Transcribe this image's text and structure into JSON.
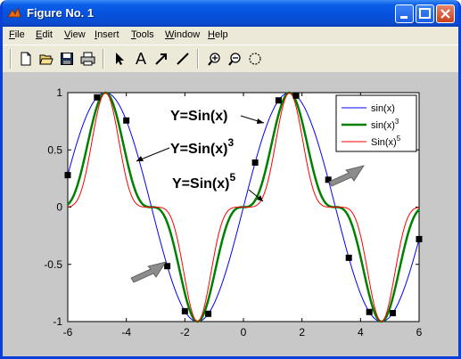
{
  "window": {
    "title": "Figure No. 1"
  },
  "menu": [
    {
      "u": "F",
      "rest": "ile"
    },
    {
      "u": "E",
      "rest": "dit"
    },
    {
      "u": "V",
      "rest": "iew"
    },
    {
      "u": "I",
      "rest": "nsert"
    },
    {
      "u": "T",
      "rest": "ools"
    },
    {
      "u": "W",
      "rest": "indow"
    },
    {
      "u": "H",
      "rest": "elp"
    }
  ],
  "toolbar": {
    "icons": [
      "new-file-icon",
      "open-folder-icon",
      "save-icon",
      "print-icon",
      "select-arrow-icon",
      "insert-text-icon",
      "insert-arrow-icon",
      "insert-line-icon",
      "zoom-in-icon",
      "zoom-out-icon",
      "rotate-3d-icon"
    ],
    "text_tool_label": "A"
  },
  "chart_data": {
    "type": "line",
    "xlim": [
      -6,
      6
    ],
    "ylim": [
      -1,
      1
    ],
    "xticks": [
      "-6",
      "-4",
      "-2",
      "0",
      "2",
      "4",
      "6"
    ],
    "yticks": [
      "1",
      "0.5",
      "0",
      "-0.5",
      "-1"
    ],
    "legend_position": "top-right",
    "series": [
      {
        "name": "sin(x)",
        "expr": "sin",
        "power": 1,
        "color": "#0000ff",
        "width": 1
      },
      {
        "name": "sin(x)³",
        "expr": "sin",
        "power": 3,
        "color": "#008000",
        "width": 2.5
      },
      {
        "name": "Sin(x)⁵",
        "expr": "sin",
        "power": 5,
        "color": "#ff0000",
        "width": 1
      }
    ],
    "legend": {
      "entries": [
        {
          "base": "sin(x)",
          "sup": ""
        },
        {
          "base": "sin(x)",
          "sup": "3"
        },
        {
          "base": "Sin(x)",
          "sup": "5"
        }
      ]
    },
    "markers_x": [
      -6,
      -5.0,
      -4.0,
      -2.6,
      -2.0,
      -1.2,
      0.4,
      1.2,
      1.8,
      2.9,
      3.6,
      4.3,
      5.1,
      6.0
    ],
    "annotations": [
      {
        "base": "Y=Sin(x)",
        "sup": ""
      },
      {
        "base": "Y=Sin(x)",
        "sup": "3"
      },
      {
        "base": "Y=Sin(x)",
        "sup": "5"
      }
    ]
  }
}
